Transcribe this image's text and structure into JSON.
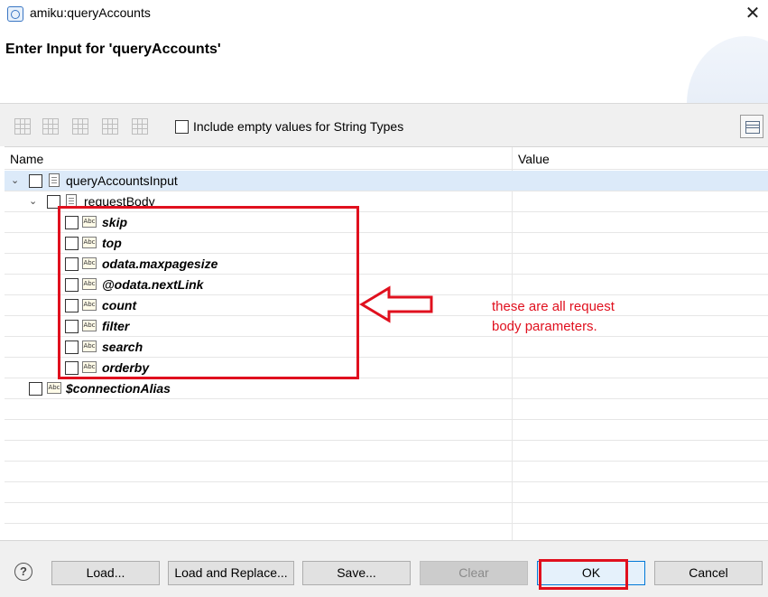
{
  "window": {
    "title": "amiku:queryAccounts",
    "close_glyph": "✕"
  },
  "dialog": {
    "heading": "Enter Input for 'queryAccounts'"
  },
  "toolbar": {
    "icons": [
      "add-row-icon",
      "remove-row-icon",
      "table-icon",
      "delete-icon",
      "clear-icon",
      "layout-icon"
    ],
    "include_empty_label": "Include empty values for String Types",
    "include_empty_checked": false
  },
  "tree": {
    "columns": {
      "name": "Name",
      "value": "Value"
    },
    "root": {
      "label": "queryAccountsInput",
      "expanded": true,
      "selected": true,
      "checked": false
    },
    "request_body": {
      "label": "requestBody",
      "expanded": true,
      "checked": false
    },
    "params": [
      {
        "label": "skip",
        "type_icon": "Abc"
      },
      {
        "label": "top",
        "type_icon": "Abc"
      },
      {
        "label": "odata.maxpagesize",
        "type_icon": "Abc"
      },
      {
        "label": "@odata.nextLink",
        "type_icon": "Abc"
      },
      {
        "label": "count",
        "type_icon": "Abc"
      },
      {
        "label": "filter",
        "type_icon": "Abc"
      },
      {
        "label": "search",
        "type_icon": "Abc"
      },
      {
        "label": "orderby",
        "type_icon": "Abc"
      }
    ],
    "connection_alias": {
      "label": "$connectionAlias",
      "type_icon": "Abc"
    }
  },
  "annotation": {
    "line1": "these are all request",
    "line2": "body parameters.",
    "color": "#e0101e"
  },
  "footer": {
    "help_glyph": "?",
    "load": "Load...",
    "load_replace": "Load and Replace...",
    "save": "Save...",
    "clear": "Clear",
    "ok": "OK",
    "cancel": "Cancel"
  }
}
